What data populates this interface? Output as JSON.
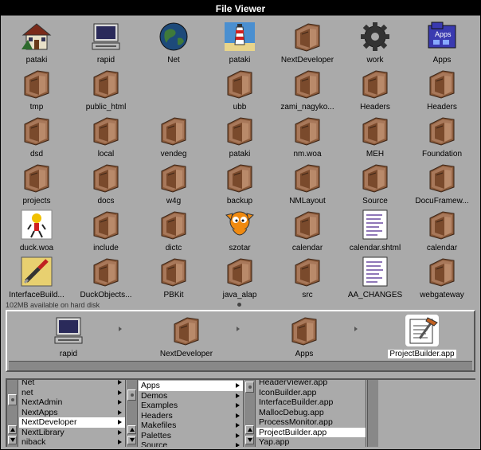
{
  "window": {
    "title": "File Viewer"
  },
  "shelf": {
    "items": [
      {
        "label": "pataki",
        "icon": "house-icon"
      },
      {
        "label": "rapid",
        "icon": "computer-icon"
      },
      {
        "label": "Net",
        "icon": "globe-icon"
      },
      {
        "label": "pataki",
        "icon": "lighthouse-icon"
      },
      {
        "label": "NextDeveloper",
        "icon": "folder-icon"
      },
      {
        "label": "work",
        "icon": "gear-icon"
      },
      {
        "label": "Apps",
        "icon": "apps-folder-icon"
      },
      {
        "label": "tmp",
        "icon": "folder-icon"
      },
      {
        "label": "public_html",
        "icon": "folder-icon"
      },
      {
        "label": "",
        "icon": ""
      },
      {
        "label": "ubb",
        "icon": "folder-icon"
      },
      {
        "label": "zami_nagyko...",
        "icon": "folder-icon"
      },
      {
        "label": "Headers",
        "icon": "folder-icon"
      },
      {
        "label": "Headers",
        "icon": "folder-icon"
      },
      {
        "label": "dsd",
        "icon": "folder-icon"
      },
      {
        "label": "local",
        "icon": "folder-icon"
      },
      {
        "label": "vendeg",
        "icon": "folder-icon"
      },
      {
        "label": "pataki",
        "icon": "folder-icon"
      },
      {
        "label": "nm.woa",
        "icon": "folder-icon"
      },
      {
        "label": "MEH",
        "icon": "folder-icon"
      },
      {
        "label": "Foundation",
        "icon": "folder-icon"
      },
      {
        "label": "projects",
        "icon": "folder-icon"
      },
      {
        "label": "docs",
        "icon": "folder-icon"
      },
      {
        "label": "w4g",
        "icon": "folder-icon"
      },
      {
        "label": "backup",
        "icon": "folder-icon"
      },
      {
        "label": "NMLayout",
        "icon": "folder-icon"
      },
      {
        "label": "Source",
        "icon": "folder-icon"
      },
      {
        "label": "DocuFramew...",
        "icon": "folder-icon"
      },
      {
        "label": "duck.woa",
        "icon": "duck-icon"
      },
      {
        "label": "include",
        "icon": "folder-icon"
      },
      {
        "label": "dictc",
        "icon": "folder-icon"
      },
      {
        "label": "szotar",
        "icon": "garfield-icon"
      },
      {
        "label": "calendar",
        "icon": "folder-icon"
      },
      {
        "label": "calendar.shtml",
        "icon": "document-icon"
      },
      {
        "label": "calendar",
        "icon": "folder-icon"
      },
      {
        "label": "InterfaceBuild...",
        "icon": "screwdriver-icon"
      },
      {
        "label": "DuckObjects...",
        "icon": "folder-icon"
      },
      {
        "label": "PBKit",
        "icon": "folder-icon"
      },
      {
        "label": "java_alap",
        "icon": "folder-icon"
      },
      {
        "label": "src",
        "icon": "folder-icon"
      },
      {
        "label": "AA_CHANGES",
        "icon": "document-icon"
      },
      {
        "label": "webgateway",
        "icon": "folder-icon"
      }
    ]
  },
  "status": {
    "disk": "102MB available on hard disk"
  },
  "path": {
    "items": [
      {
        "label": "rapid",
        "icon": "computer-icon"
      },
      {
        "label": "NextDeveloper",
        "icon": "folder-icon"
      },
      {
        "label": "Apps",
        "icon": "folder-icon"
      },
      {
        "label": "ProjectBuilder.app",
        "icon": "project-builder-icon"
      }
    ]
  },
  "browser": {
    "col1": [
      "Net",
      "net",
      "NextAdmin",
      "NextApps",
      "NextDeveloper",
      "NextLibrary",
      "niback"
    ],
    "col1_selected": 4,
    "col2": [
      "Apps",
      "Demos",
      "Examples",
      "Headers",
      "Makefiles",
      "Palettes",
      "Source"
    ],
    "col2_selected": 0,
    "col3": [
      "HeaderViewer.app",
      "IconBuilder.app",
      "InterfaceBuilder.app",
      "MallocDebug.app",
      "ProcessMonitor.app",
      "ProjectBuilder.app",
      "Yap.app"
    ],
    "col3_selected": 5
  }
}
